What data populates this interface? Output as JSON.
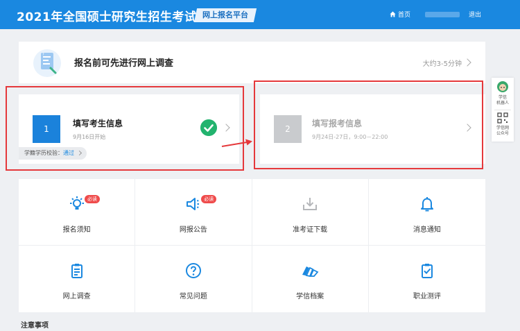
{
  "header": {
    "title": "2021年全国硕士研究生招生考试",
    "platform_badge": "网上报名平台",
    "home_label": "首页",
    "logout_label": "退出"
  },
  "survey": {
    "text": "报名前可先进行网上调查",
    "duration": "大约3-5分钟"
  },
  "steps": [
    {
      "number": "1",
      "title": "填写考生信息",
      "date": "9月16日开始",
      "status": "completed",
      "verify_label": "学籍学历校验：",
      "verify_status": "通过"
    },
    {
      "number": "2",
      "title": "填写报考信息",
      "date": "9月24日-27日，9:00－22:00",
      "status": "inactive"
    }
  ],
  "grid": {
    "items": [
      {
        "label": "报名须知",
        "icon": "lightbulb-icon",
        "badge": "必读"
      },
      {
        "label": "网报公告",
        "icon": "megaphone-icon",
        "badge": "必读"
      },
      {
        "label": "准考证下载",
        "icon": "download-icon",
        "disabled": true
      },
      {
        "label": "消息通知",
        "icon": "bell-icon"
      },
      {
        "label": "网上调查",
        "icon": "clipboard-icon"
      },
      {
        "label": "常见问题",
        "icon": "question-icon"
      },
      {
        "label": "学信档案",
        "icon": "archive-icon"
      },
      {
        "label": "职业测评",
        "icon": "checklist-icon"
      }
    ]
  },
  "notes_title": "注意事项",
  "side": {
    "robot_label_1": "学信",
    "robot_label_2": "机器人",
    "qr_label_1": "学信网",
    "qr_label_2": "公众号"
  },
  "colors": {
    "header_blue": "#1a88e0",
    "accent_blue": "#1b82db",
    "check_green": "#22b36e",
    "highlight_red": "#e5383b",
    "badge_red": "#ef4b4b"
  }
}
